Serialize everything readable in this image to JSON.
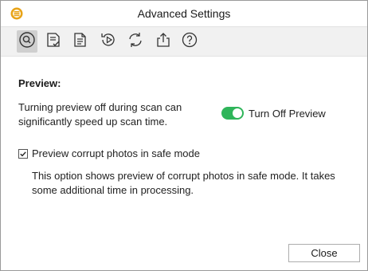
{
  "window": {
    "title": "Advanced Settings"
  },
  "toolbar": {
    "items": [
      {
        "icon": "preview-icon",
        "active": true
      },
      {
        "icon": "scan-settings-icon",
        "active": false
      },
      {
        "icon": "file-list-icon",
        "active": false
      },
      {
        "icon": "resume-recovery-icon",
        "active": false
      },
      {
        "icon": "update-icon",
        "active": false
      },
      {
        "icon": "export-icon",
        "active": false
      },
      {
        "icon": "help-icon",
        "active": false
      }
    ]
  },
  "preview": {
    "heading": "Preview:",
    "description": "Turning preview off during scan can significantly speed up scan time.",
    "toggle_label": "Turn Off Preview",
    "toggle_on": true,
    "toggle_color": "#2fb55a"
  },
  "corrupt_option": {
    "label": "Preview corrupt photos in safe mode",
    "checked": true,
    "description": "This option shows preview of corrupt photos in safe mode. It takes some additional time in processing."
  },
  "footer": {
    "close_label": "Close"
  },
  "colors": {
    "accent": "#e8a317",
    "toolbar_bg": "#f1f1f1"
  }
}
